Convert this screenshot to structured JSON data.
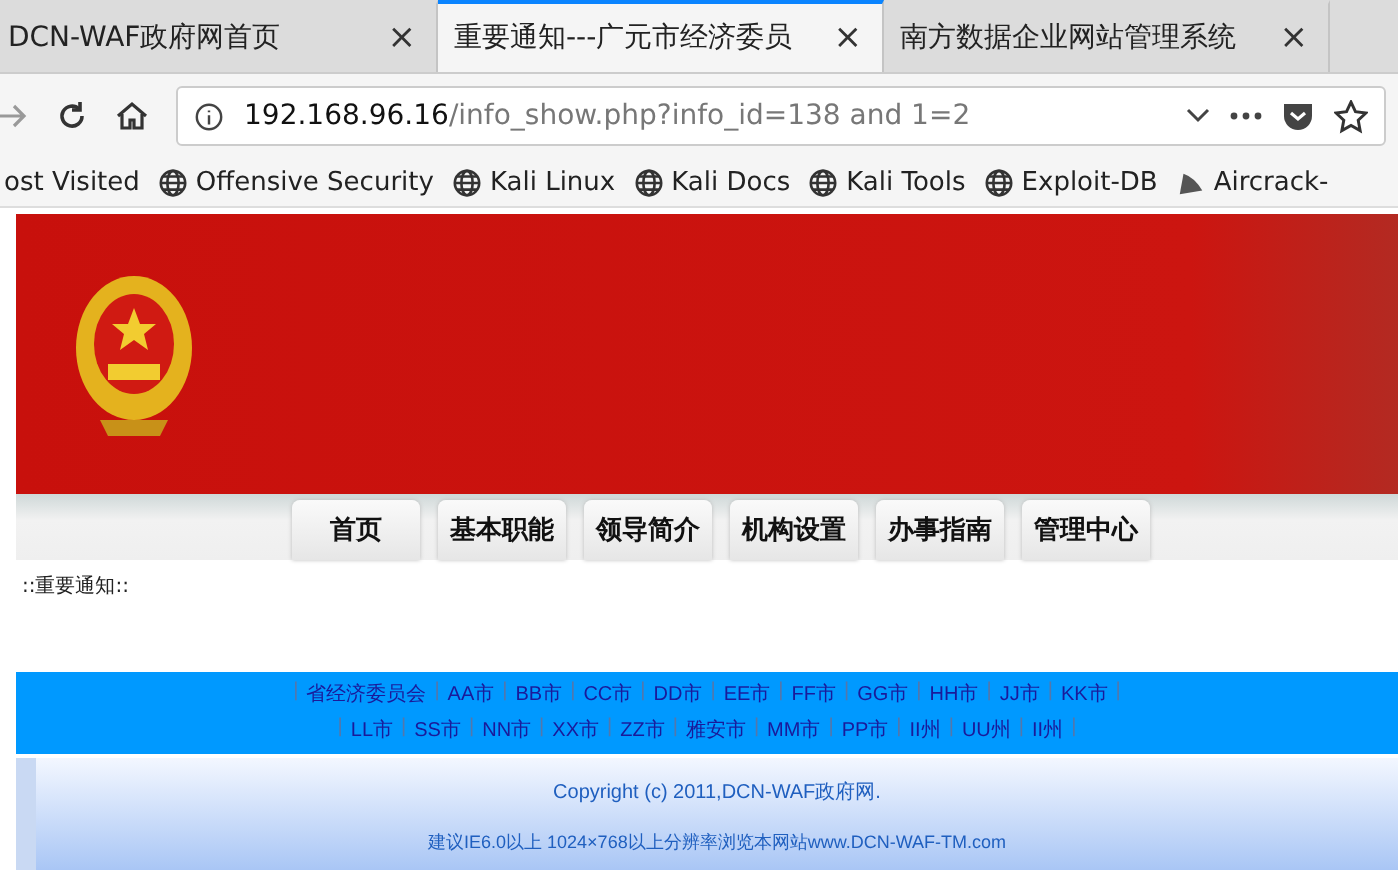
{
  "tabs": [
    {
      "title": "DCN-WAF政府网首页",
      "selected": false,
      "close": "×"
    },
    {
      "title": "重要通知---广元市经济委员",
      "selected": true,
      "close": "×"
    },
    {
      "title": "南方数据企业网站管理系统",
      "selected": false,
      "close": "×"
    }
  ],
  "address": {
    "host": "192.168.96.16",
    "path": "/info_show.php?info_id=138 and 1=2"
  },
  "bookmarks": [
    {
      "label": "ost Visited",
      "kind": "plain"
    },
    {
      "label": "Offensive Security",
      "kind": "globe"
    },
    {
      "label": "Kali Linux",
      "kind": "globe"
    },
    {
      "label": "Kali Docs",
      "kind": "globe"
    },
    {
      "label": "Kali Tools",
      "kind": "globe"
    },
    {
      "label": "Exploit-DB",
      "kind": "globe"
    },
    {
      "label": "Aircrack-",
      "kind": "dish"
    }
  ],
  "menu": [
    "首页",
    "基本职能",
    "领导简介",
    "机构设置",
    "办事指南",
    "管理中心"
  ],
  "notice": "::重要通知::",
  "links": {
    "separator": "|",
    "rows": [
      [
        "省经济委员会",
        "AA市",
        "BB市",
        "CC市",
        "DD市",
        "EE市",
        "FF市",
        "GG市",
        "HH市",
        "JJ市",
        "KK市"
      ],
      [
        "LL市",
        "SS市",
        "NN市",
        "XX市",
        "ZZ市",
        "雅安市",
        "MM市",
        "PP市",
        "II州",
        "UU州",
        "II州"
      ]
    ]
  },
  "copyright": "Copyright (c) 2011,DCN-WAF政府网.",
  "advice": "建议IE6.0以上 1024×768以上分辨率浏览本网站www.DCN-WAF-TM.com"
}
